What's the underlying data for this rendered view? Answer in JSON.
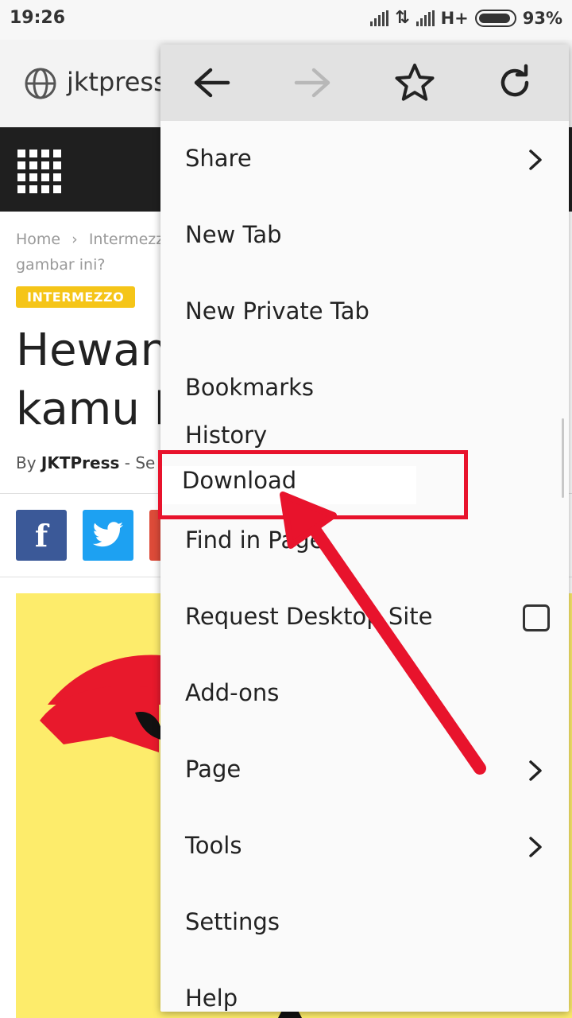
{
  "status_bar": {
    "time": "19:26",
    "network": "H+",
    "battery": "93%",
    "battery_level": 0.93
  },
  "url_bar": {
    "url": "jktpress."
  },
  "breadcrumb": {
    "home": "Home",
    "separator": "›",
    "category": "Intermezz",
    "title_cont": "gambar ini?"
  },
  "article": {
    "category": "INTERMEZZO",
    "headline_line1": "Hewan",
    "headline_line2": "kamu li",
    "by": "By",
    "author": "JKTPress",
    "date_sep": "-",
    "date": "Se"
  },
  "share": {
    "facebook": "f",
    "twitter": "twitter",
    "third": ""
  },
  "menu": {
    "toolbar": [
      "back-arrow-icon",
      "forward-arrow-icon",
      "star-icon",
      "reload-icon"
    ],
    "items": [
      {
        "label": "Share"
      },
      {
        "label": "New Tab"
      },
      {
        "label": "New Private Tab"
      },
      {
        "label": "Bookmarks"
      },
      {
        "label": "History"
      },
      {
        "label": "Download"
      },
      {
        "label": "Find in Page"
      },
      {
        "label": "Request Desktop Site",
        "checked": false
      },
      {
        "label": "Add-ons"
      },
      {
        "label": "Page"
      },
      {
        "label": "Tools"
      },
      {
        "label": "Settings"
      },
      {
        "label": "Help"
      }
    ]
  },
  "colors": {
    "annotation": "#e8132c",
    "badge": "#f5c518",
    "facebook": "#3b5998",
    "twitter": "#1da1f2"
  }
}
